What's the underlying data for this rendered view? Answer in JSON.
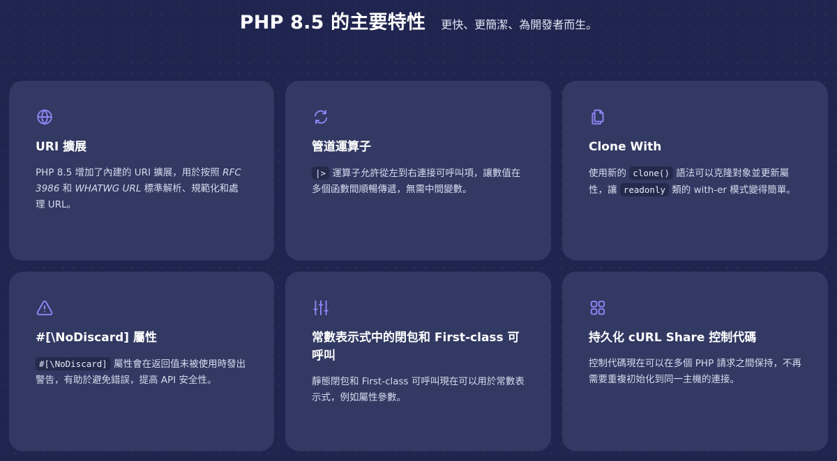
{
  "header": {
    "title": "PHP 8.5 的主要特性",
    "subtitle": "更快、更簡潔、為開發者而生。"
  },
  "colors": {
    "background": "#20254f",
    "card": "#323962",
    "accent_icon": "#8f84f5",
    "code_bg": "#242a4c"
  },
  "cards": [
    {
      "icon": "globe-icon",
      "title": "URI 擴展",
      "body": {
        "p1": "PHP 8.5 增加了內建的 URI 擴展，用於按照 ",
        "em1": "RFC 3986",
        "p2": " 和 ",
        "em2": "WHATWG URL",
        "p3": " 標準解析、規範化和處理 URL。"
      }
    },
    {
      "icon": "refresh-icon",
      "title": "管道運算子",
      "body": {
        "code1": "|>",
        "p1": " 運算子允許從左到右連接可呼叫項，讓數值在多個函數間順暢傳遞，無需中間變數。"
      }
    },
    {
      "icon": "copy-icon",
      "title": "Clone With",
      "body": {
        "p1": "使用新的 ",
        "code1": "clone()",
        "p2": " 語法可以克隆對象並更新屬性，讓 ",
        "code2": "readonly",
        "p3": " 類的 with-er 模式變得簡單。"
      }
    },
    {
      "icon": "warning-icon",
      "title": "#[\\NoDiscard] 屬性",
      "body": {
        "code1": "#[\\NoDiscard]",
        "p1": " 屬性會在返回值未被使用時發出警告，有助於避免錯誤，提高 API 安全性。"
      }
    },
    {
      "icon": "sliders-icon",
      "title": "常數表示式中的閉包和 First-class 可呼叫",
      "body": {
        "p1": "靜態閉包和 First-class 可呼叫現在可以用於常數表示式，例如屬性參數。"
      }
    },
    {
      "icon": "grid-icon",
      "title": "持久化 cURL Share 控制代碼",
      "body": {
        "p1": "控制代碼現在可以在多個 PHP 請求之間保持，不再需要重複初始化到同一主機的連接。"
      }
    }
  ]
}
